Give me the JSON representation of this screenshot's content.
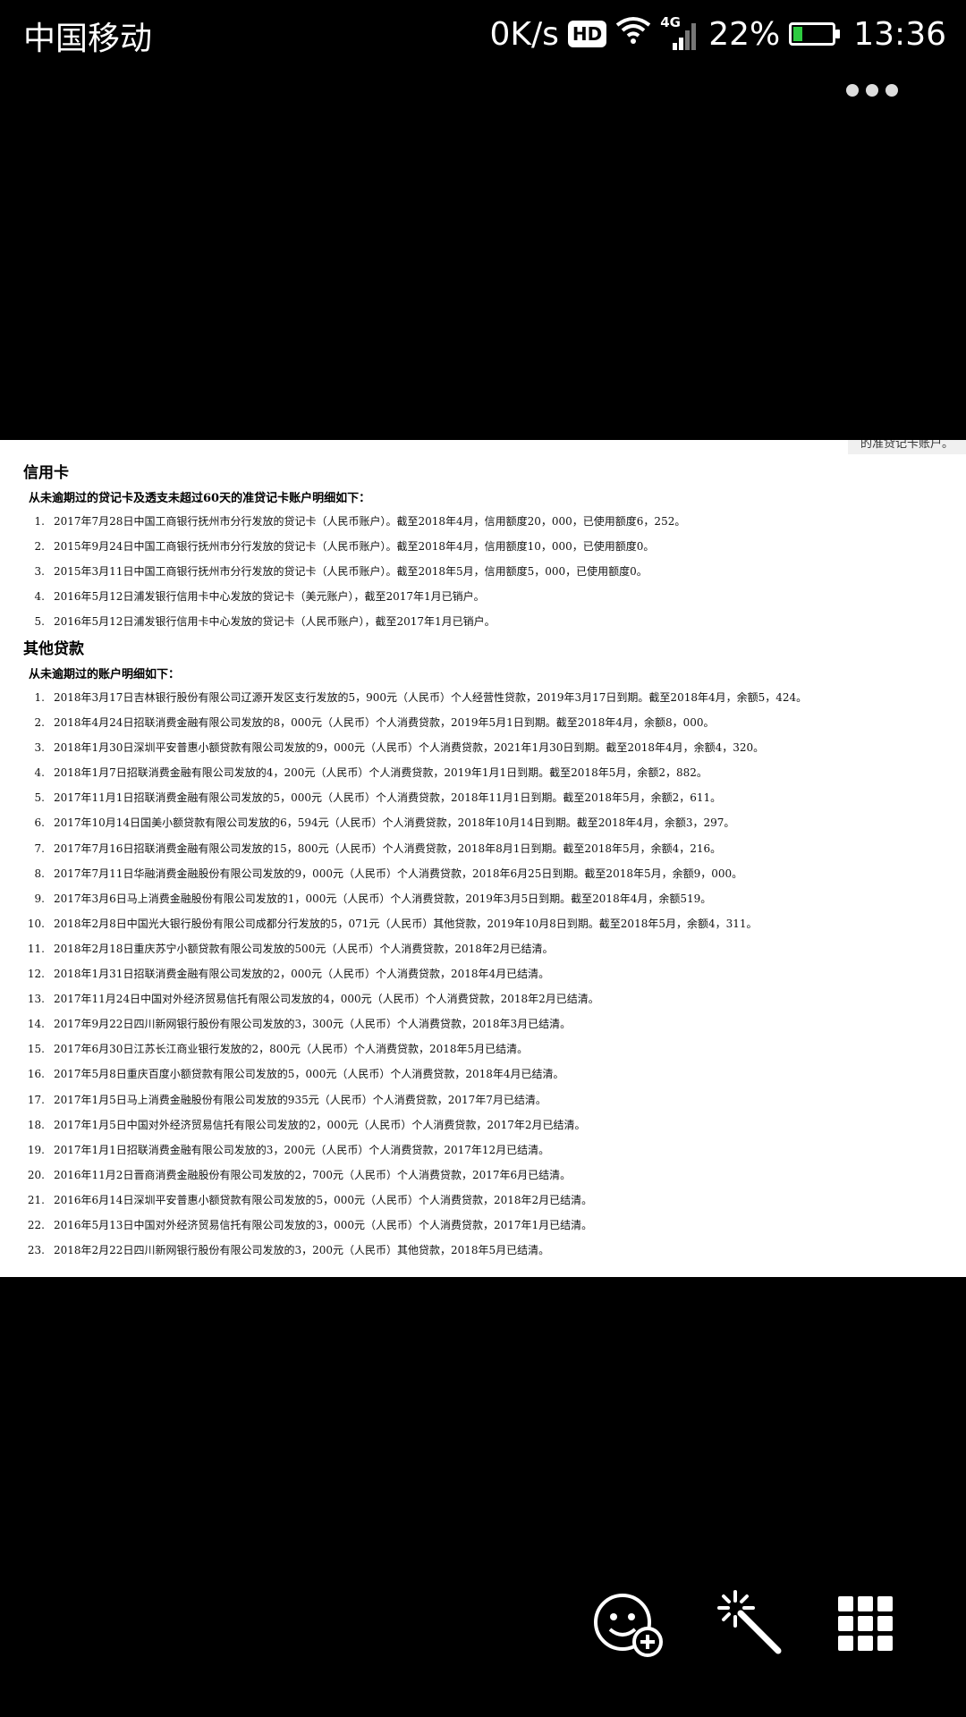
{
  "status_bar": {
    "carrier": "中国移动",
    "speed": "0K/s",
    "hd": "HD",
    "network": "4G",
    "battery": "22%",
    "time": "13:36"
  },
  "document": {
    "top_cut_text": "的准贷记卡账户。",
    "credit_card": {
      "title": "信用卡",
      "subtitle": "从未逾期过的贷记卡及透支未超过60天的准贷记卡账户明细如下：",
      "items": [
        {
          "num": "1.",
          "text": "2017年7月28日中国工商银行抚州市分行发放的贷记卡（人民币账户）。截至2018年4月，信用额度20，000，已使用额度6，252。"
        },
        {
          "num": "2.",
          "text": "2015年9月24日中国工商银行抚州市分行发放的贷记卡（人民币账户）。截至2018年4月，信用额度10，000，已使用额度0。"
        },
        {
          "num": "3.",
          "text": "2015年3月11日中国工商银行抚州市分行发放的贷记卡（人民币账户）。截至2018年5月，信用额度5，000，已使用额度0。"
        },
        {
          "num": "4.",
          "text": "2016年5月12日浦发银行信用卡中心发放的贷记卡（美元账户），截至2017年1月已销户。"
        },
        {
          "num": "5.",
          "text": "2016年5月12日浦发银行信用卡中心发放的贷记卡（人民币账户），截至2017年1月已销户。"
        }
      ]
    },
    "other_loans": {
      "title": "其他贷款",
      "subtitle": "从未逾期过的账户明细如下：",
      "items": [
        {
          "num": "1.",
          "text": "2018年3月17日吉林银行股份有限公司辽源开发区支行发放的5，900元（人民币）个人经营性贷款，2019年3月17日到期。截至2018年4月，余额5，424。"
        },
        {
          "num": "2.",
          "text": "2018年4月24日招联消费金融有限公司发放的8，000元（人民币）个人消费贷款，2019年5月1日到期。截至2018年4月，余额8，000。"
        },
        {
          "num": "3.",
          "text": "2018年1月30日深圳平安普惠小额贷款有限公司发放的9，000元（人民币）个人消费贷款，2021年1月30日到期。截至2018年4月，余额4，320。"
        },
        {
          "num": "4.",
          "text": "2018年1月7日招联消费金融有限公司发放的4，200元（人民币）个人消费贷款，2019年1月1日到期。截至2018年5月，余额2，882。"
        },
        {
          "num": "5.",
          "text": "2017年11月1日招联消费金融有限公司发放的5，000元（人民币）个人消费贷款，2018年11月1日到期。截至2018年5月，余额2，611。"
        },
        {
          "num": "6.",
          "text": "2017年10月14日国美小额贷款有限公司发放的6，594元（人民币）个人消费贷款，2018年10月14日到期。截至2018年4月，余额3，297。"
        },
        {
          "num": "7.",
          "text": "2017年7月16日招联消费金融有限公司发放的15，800元（人民币）个人消费贷款，2018年8月1日到期。截至2018年5月，余额4，216。"
        },
        {
          "num": "8.",
          "text": "2017年7月11日华融消费金融股份有限公司发放的9，000元（人民币）个人消费贷款，2018年6月25日到期。截至2018年5月，余额9，000。"
        },
        {
          "num": "9.",
          "text": "2017年3月6日马上消费金融股份有限公司发放的1，000元（人民币）个人消费贷款，2019年3月5日到期。截至2018年4月，余额519。"
        },
        {
          "num": "10.",
          "text": "2018年2月8日中国光大银行股份有限公司成都分行发放的5，071元（人民币）其他贷款，2019年10月8日到期。截至2018年5月，余额4，311。"
        },
        {
          "num": "11.",
          "text": "2018年2月18日重庆苏宁小额贷款有限公司发放的500元（人民币）个人消费贷款，2018年2月已结清。"
        },
        {
          "num": "12.",
          "text": "2018年1月31日招联消费金融有限公司发放的2，000元（人民币）个人消费贷款，2018年4月已结清。"
        },
        {
          "num": "13.",
          "text": "2017年11月24日中国对外经济贸易信托有限公司发放的4，000元（人民币）个人消费贷款，2018年2月已结清。"
        },
        {
          "num": "14.",
          "text": "2017年9月22日四川新网银行股份有限公司发放的3，300元（人民币）个人消费贷款，2018年3月已结清。"
        },
        {
          "num": "15.",
          "text": "2017年6月30日江苏长江商业银行发放的2，800元（人民币）个人消费贷款，2018年5月已结清。"
        },
        {
          "num": "16.",
          "text": "2017年5月8日重庆百度小额贷款有限公司发放的5，000元（人民币）个人消费贷款，2018年4月已结清。"
        },
        {
          "num": "17.",
          "text": "2017年1月5日马上消费金融股份有限公司发放的935元（人民币）个人消费贷款，2017年7月已结清。"
        },
        {
          "num": "18.",
          "text": "2017年1月5日中国对外经济贸易信托有限公司发放的2，000元（人民币）个人消费贷款，2017年2月已结清。"
        },
        {
          "num": "19.",
          "text": "2017年1月1日招联消费金融有限公司发放的3，200元（人民币）个人消费贷款，2017年12月已结清。"
        },
        {
          "num": "20.",
          "text": "2016年11月2日晋商消费金融股份有限公司发放的2，700元（人民币）个人消费贷款，2017年6月已结清。"
        },
        {
          "num": "21.",
          "text": "2016年6月14日深圳平安普惠小额贷款有限公司发放的5，000元（人民币）个人消费贷款，2018年2月已结清。"
        },
        {
          "num": "22.",
          "text": "2016年5月13日中国对外经济贸易信托有限公司发放的3，000元（人民币）个人消费贷款，2017年1月已结清。"
        },
        {
          "num": "23.",
          "text": "2018年2月22日四川新网银行股份有限公司发放的3，200元（人民币）其他贷款，2018年5月已结清。"
        }
      ]
    }
  },
  "toolbar": {
    "icons": [
      "add-emoji-icon",
      "magic-wand-icon",
      "grid-icon"
    ]
  }
}
